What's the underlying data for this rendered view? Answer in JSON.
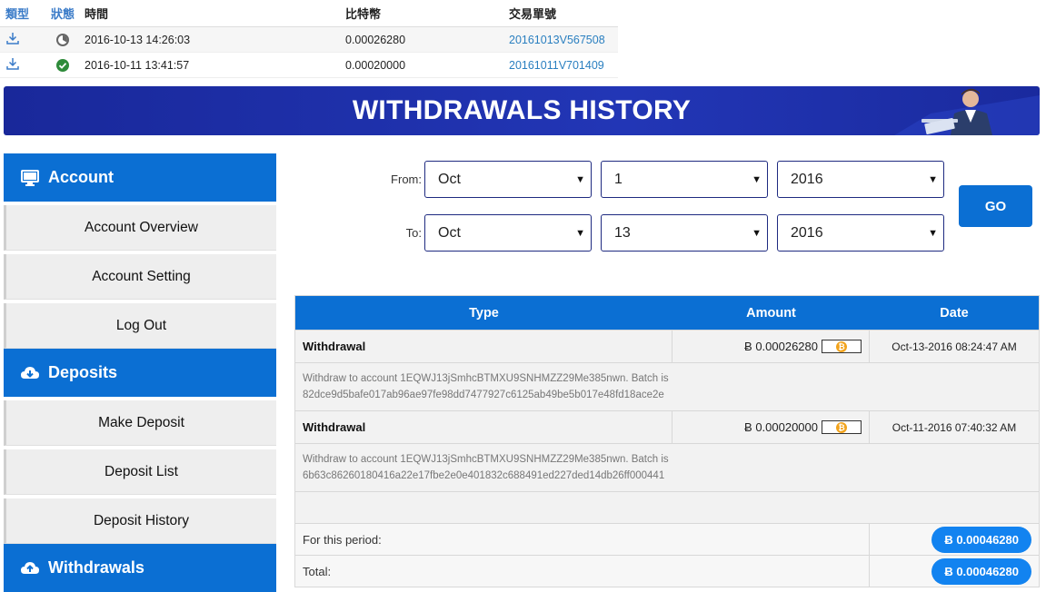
{
  "tx_table": {
    "headers": {
      "type": "類型",
      "status": "狀態",
      "time": "時間",
      "btc": "比特幣",
      "txid": "交易單號"
    },
    "rows": [
      {
        "icon": "download-icon",
        "status_icon": "pending-icon",
        "time": "2016-10-13 14:26:03",
        "btc": "0.00026280",
        "txid": "20161013V567508"
      },
      {
        "icon": "download-icon",
        "status_icon": "check-circle-icon",
        "time": "2016-10-11 13:41:57",
        "btc": "0.00020000",
        "txid": "20161011V701409"
      }
    ]
  },
  "banner": {
    "title": "WITHDRAWALS HISTORY"
  },
  "sidebar": {
    "sections": [
      {
        "title": "Account",
        "icon": "monitor-icon",
        "items": [
          "Account Overview",
          "Account Setting",
          "Log Out"
        ]
      },
      {
        "title": "Deposits",
        "icon": "cloud-download-icon",
        "items": [
          "Make Deposit",
          "Deposit List",
          "Deposit History"
        ]
      },
      {
        "title": "Withdrawals",
        "icon": "cloud-upload-icon",
        "items": []
      }
    ]
  },
  "filter": {
    "from_label": "From:",
    "to_label": "To:",
    "from": {
      "month": "Oct",
      "day": "1",
      "year": "2016"
    },
    "to": {
      "month": "Oct",
      "day": "13",
      "year": "2016"
    },
    "go_label": "GO"
  },
  "withdrawals": {
    "headers": {
      "type": "Type",
      "amount": "Amount",
      "date": "Date"
    },
    "rows": [
      {
        "type": "Withdrawal",
        "amount": "Ƀ 0.00026280",
        "date": "Oct-13-2016 08:24:47 AM",
        "desc_line1": "Withdraw to account 1EQWJ13jSmhcBTMXU9SNHMZZ29Me385nwn. Batch is",
        "desc_line2": "82dce9d5bafe017ab96ae97fe98dd7477927c6125ab49be5b017e48fd18ace2e"
      },
      {
        "type": "Withdrawal",
        "amount": "Ƀ 0.00020000",
        "date": "Oct-11-2016 07:40:32 AM",
        "desc_line1": "Withdraw to account 1EQWJ13jSmhcBTMXU9SNHMZZ29Me385nwn. Batch is",
        "desc_line2": "6b63c86260180416a22e17fbe2e0e401832c688491ed227ded14db26ff000441"
      }
    ],
    "period_label": "For this period:",
    "period_total": "Ƀ 0.00046280",
    "total_label": "Total:",
    "total": "Ƀ 0.00046280"
  },
  "colors": {
    "primary": "#0b6fd3",
    "banner": "#1f33b0",
    "pill": "#1283f0",
    "bitcoin": "#f2a31c",
    "success": "#2e8b3a"
  }
}
